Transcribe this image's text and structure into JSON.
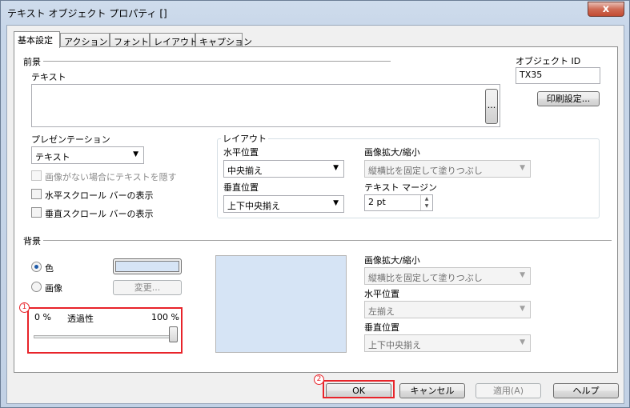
{
  "window": {
    "title": "テキスト オブジェクト プロパティ []",
    "close_glyph": "x"
  },
  "tabs": [
    {
      "label": "基本設定",
      "active": true
    },
    {
      "label": "アクション"
    },
    {
      "label": "フォント"
    },
    {
      "label": "レイアウト"
    },
    {
      "label": "キャプション"
    }
  ],
  "foreground": {
    "section_label": "前景",
    "text_label": "テキスト",
    "text_value": "",
    "browse_button": "..."
  },
  "object_id": {
    "label": "オブジェクト ID",
    "value": "TX35",
    "print_button": "印刷設定..."
  },
  "presentation": {
    "label": "プレゼンテーション",
    "selected": "テキスト",
    "hide_text_checkbox": "画像がない場合にテキストを隠す",
    "hscroll_checkbox": "水平スクロール バーの表示",
    "vscroll_checkbox": "垂直スクロール バーの表示"
  },
  "layout": {
    "label": "レイアウト",
    "h_position_label": "水平位置",
    "h_position_value": "中央揃え",
    "v_position_label": "垂直位置",
    "v_position_value": "上下中央揃え",
    "image_scale_label": "画像拡大/縮小",
    "image_scale_value": "縦横比を固定して塗りつぶし",
    "margin_label": "テキスト マージン",
    "margin_value": "2 pt"
  },
  "background": {
    "section_label": "背景",
    "color_radio": "色",
    "image_radio": "画像",
    "change_button": "変更...",
    "swatch_color": "#d6e4f5",
    "transparency_min": "0 %",
    "transparency_label": "透過性",
    "transparency_max": "100 %",
    "transparency_level": 1.0,
    "image_scale_label": "画像拡大/縮小",
    "image_scale_value": "縦横比を固定して塗りつぶし",
    "h_position_label": "水平位置",
    "h_position_value": "左揃え",
    "v_position_label": "垂直位置",
    "v_position_value": "上下中央揃え"
  },
  "buttons": {
    "ok": "OK",
    "cancel": "キャンセル",
    "apply": "適用(A)",
    "help": "ヘルプ"
  },
  "annotations": {
    "one": "1",
    "two": "2"
  },
  "colors": {
    "annotation": "#e8242a"
  }
}
